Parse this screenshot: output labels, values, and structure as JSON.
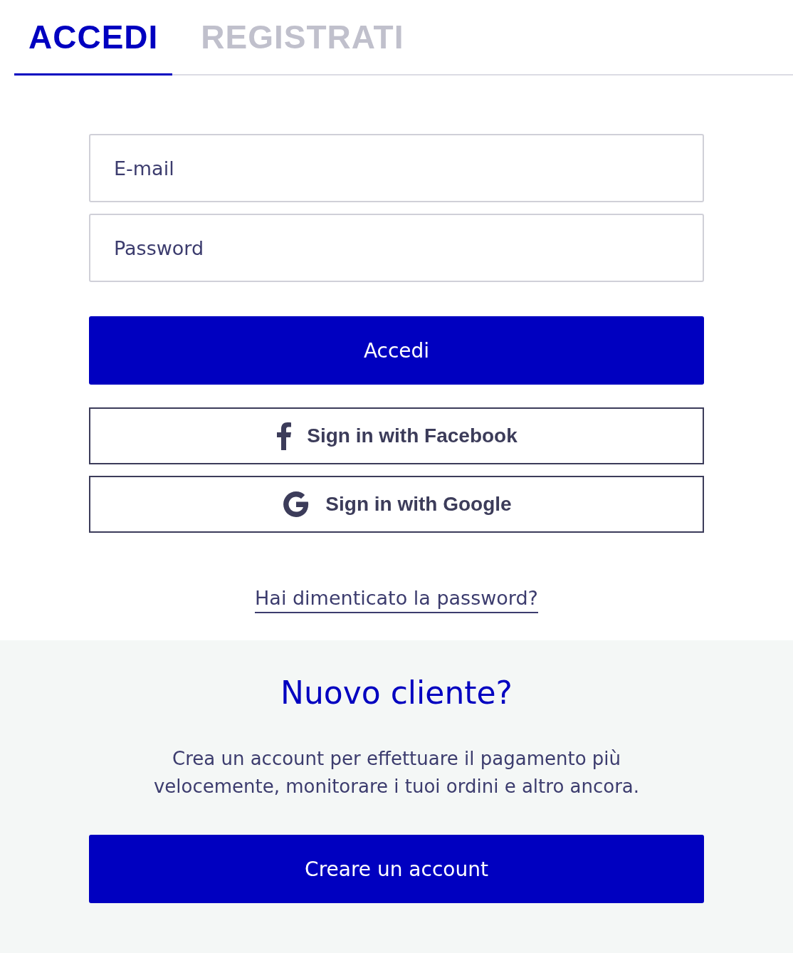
{
  "tabs": [
    {
      "label": "ACCEDI",
      "selected": true
    },
    {
      "label": "REGISTRATI",
      "selected": false
    }
  ],
  "fields": [
    {
      "placeholder": "E-mail"
    },
    {
      "placeholder": "Password"
    }
  ],
  "login_button": "Accedi",
  "social_buttons": [
    {
      "kind": "facebook",
      "label": "Sign in with Facebook"
    },
    {
      "kind": "google",
      "label": "Sign in with Google"
    }
  ],
  "forgot_link": "Hai dimenticato la password?",
  "new_customer": {
    "title": "Nuovo cliente?",
    "text": "Crea un account per effettuare il pagamento più velocemente, monitorare i tuoi ordini e altro ancora.",
    "button": "Creare un account"
  }
}
